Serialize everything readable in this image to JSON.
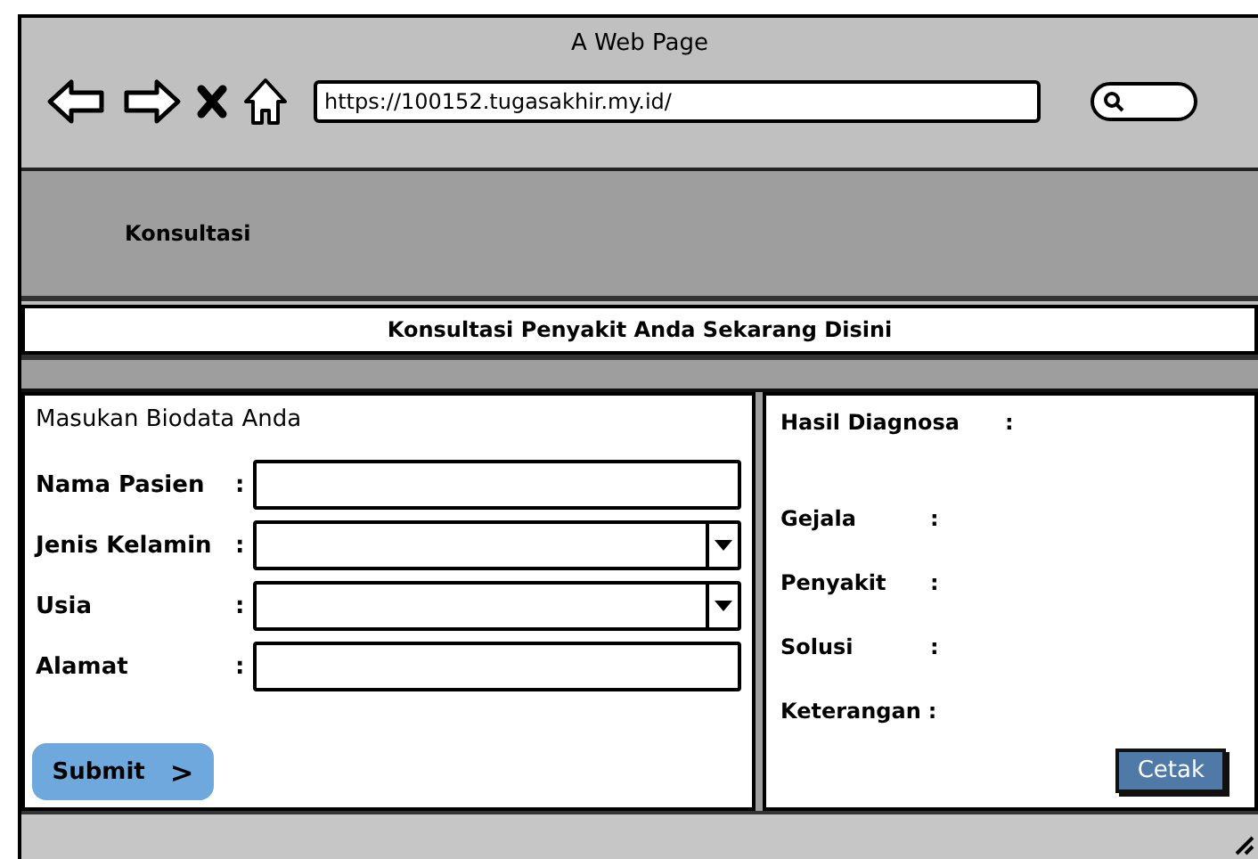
{
  "window": {
    "title": "A Web Page",
    "url": "https://100152.tugasakhir.my.id/"
  },
  "nav": {
    "items": [
      "Konsultasi"
    ]
  },
  "banner": "Konsultasi Penyakit Anda Sekarang Disini",
  "form": {
    "title": "Masukan Biodata Anda",
    "fields": [
      {
        "label": "Nama Pasien",
        "colon": ":",
        "kind": "text"
      },
      {
        "label": "Jenis Kelamin",
        "colon": ":",
        "kind": "dropdown"
      },
      {
        "label": "Usia",
        "colon": ":",
        "kind": "dropdown"
      },
      {
        "label": "Alamat",
        "colon": ":",
        "kind": "text"
      }
    ],
    "submit": {
      "label": "Submit",
      "icon": ">"
    }
  },
  "result": {
    "title": "Hasil Diagnosa",
    "title_colon": ":",
    "rows": [
      {
        "label": "Gejala",
        "colon": ":"
      },
      {
        "label": "Penyakit",
        "colon": ":"
      },
      {
        "label": "Solusi",
        "colon": ":"
      },
      {
        "label": "Keterangan",
        "colon": ":"
      }
    ],
    "print_button": "Cetak"
  }
}
